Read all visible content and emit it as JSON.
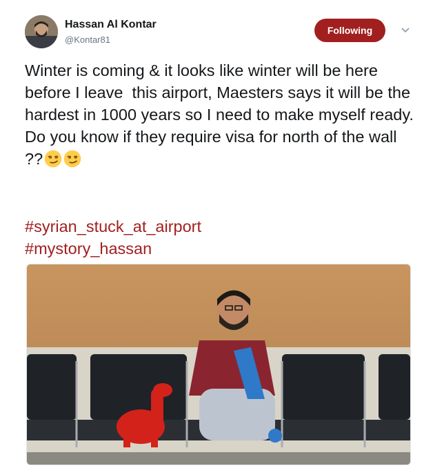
{
  "author": {
    "name": "Hassan Al Kontar",
    "handle": "@Kontar81",
    "avatar_icon": "profile-photo"
  },
  "follow_button": {
    "label": "Following",
    "color": "#a1201f"
  },
  "menu": {
    "icon": "chevron-down-icon"
  },
  "tweet": {
    "text": "Winter is coming & it looks like winter will be here before I leave  this airport, Maesters says it will be the hardest in 1000 years so I need to make myself ready.\nDo you know if they require visa for north of the wall ??",
    "emojis": [
      "smirking-face-emoji",
      "smirking-face-emoji"
    ],
    "hashtags": [
      "#syrian_stuck_at_airport",
      "#mystory_hassan"
    ]
  },
  "media": {
    "type": "photo",
    "subject": "man knitting blue scarf seated in airport chairs beside red knitted llama"
  },
  "colors": {
    "accent": "#a1201f",
    "text": "#14171a",
    "secondary": "#657786"
  }
}
